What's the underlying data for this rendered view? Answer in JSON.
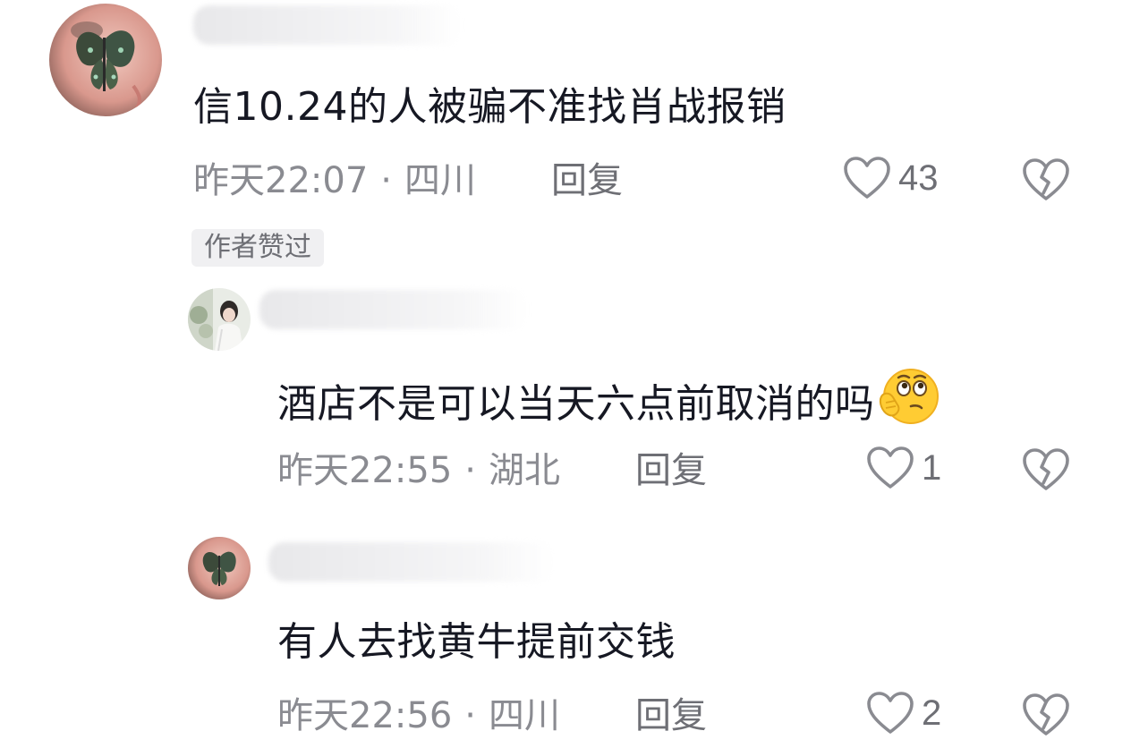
{
  "comments": [
    {
      "text": "信10.24的人被骗不准找肖战报销",
      "time": "昨天22:07",
      "location": "四川",
      "reply_label": "回复",
      "likes": "43",
      "badge": "作者赞过"
    },
    {
      "text": "酒店不是可以当天六点前取消的吗",
      "time": "昨天22:55",
      "location": "湖北",
      "reply_label": "回复",
      "likes": "1",
      "emoji": "thinking-face-emoji"
    },
    {
      "text": "有人去找黄牛提前交钱",
      "time": "昨天22:56",
      "location": "四川",
      "reply_label": "回复",
      "likes": "2"
    }
  ],
  "separator": "·",
  "colors": {
    "text": "#161823",
    "meta": "#8a8b91",
    "icon": "#8a8b91",
    "badge_bg": "#f0f0f2",
    "emoji_yellow": "#ffcc33"
  },
  "icons": {
    "like": "heart-outline-icon",
    "dislike": "broken-heart-icon"
  }
}
